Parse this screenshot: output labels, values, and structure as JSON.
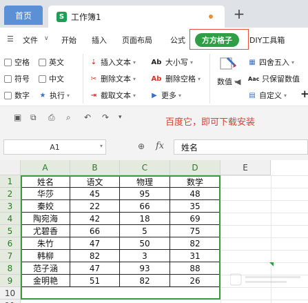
{
  "tabs": {
    "home": "首页",
    "doc_icon": "S",
    "doc_title": "工作簿1",
    "add": "+"
  },
  "menu": {
    "file": "文件",
    "file_caret": "∨",
    "items": [
      "开始",
      "插入",
      "页面布局",
      "公式",
      "DIY工具箱"
    ],
    "active": "方方格子"
  },
  "ribbon": {
    "checkboxes": [
      "空格",
      "英文",
      "符号",
      "中文",
      "数字"
    ],
    "execute": "执行",
    "insert_text": "插入文本",
    "delete_text": "删除文本",
    "cut_text": "截取文本",
    "case": "大小写",
    "case_icon": "Ab",
    "delete_space": "删除空格",
    "delete_space_icon": "Ab",
    "more": "更多",
    "numeric": "数值",
    "round": "四舍五入",
    "keep_value": "只保留数值",
    "keep_value_icon": "Aac",
    "custom": "自定义",
    "plus": "+"
  },
  "note": "百度它，即可下载安装",
  "formula_bar": {
    "cell_ref": "A1",
    "fx": "fx",
    "content": "姓名"
  },
  "sheet": {
    "columns": [
      "A",
      "B",
      "C",
      "D",
      "E"
    ],
    "rows": [
      "1",
      "2",
      "3",
      "4",
      "5",
      "6",
      "7",
      "8",
      "9",
      "10",
      "11"
    ],
    "table": [
      [
        "姓名",
        "语文",
        "物理",
        "数学"
      ],
      [
        "华莎",
        "45",
        "95",
        "48"
      ],
      [
        "秦姣",
        "22",
        "66",
        "35"
      ],
      [
        "陶宛海",
        "42",
        "18",
        "69"
      ],
      [
        "尤碧香",
        "66",
        "5",
        "75"
      ],
      [
        "朱竹",
        "47",
        "50",
        "82"
      ],
      [
        "韩柳",
        "82",
        "3",
        "31"
      ],
      [
        "范子涵",
        "47",
        "93",
        "88"
      ],
      [
        "金明艳",
        "51",
        "82",
        "26"
      ]
    ]
  },
  "colors": {
    "accent_green": "#2f9e45",
    "highlight_red": "#e23b2c",
    "home_tab": "#5b8fd6"
  }
}
